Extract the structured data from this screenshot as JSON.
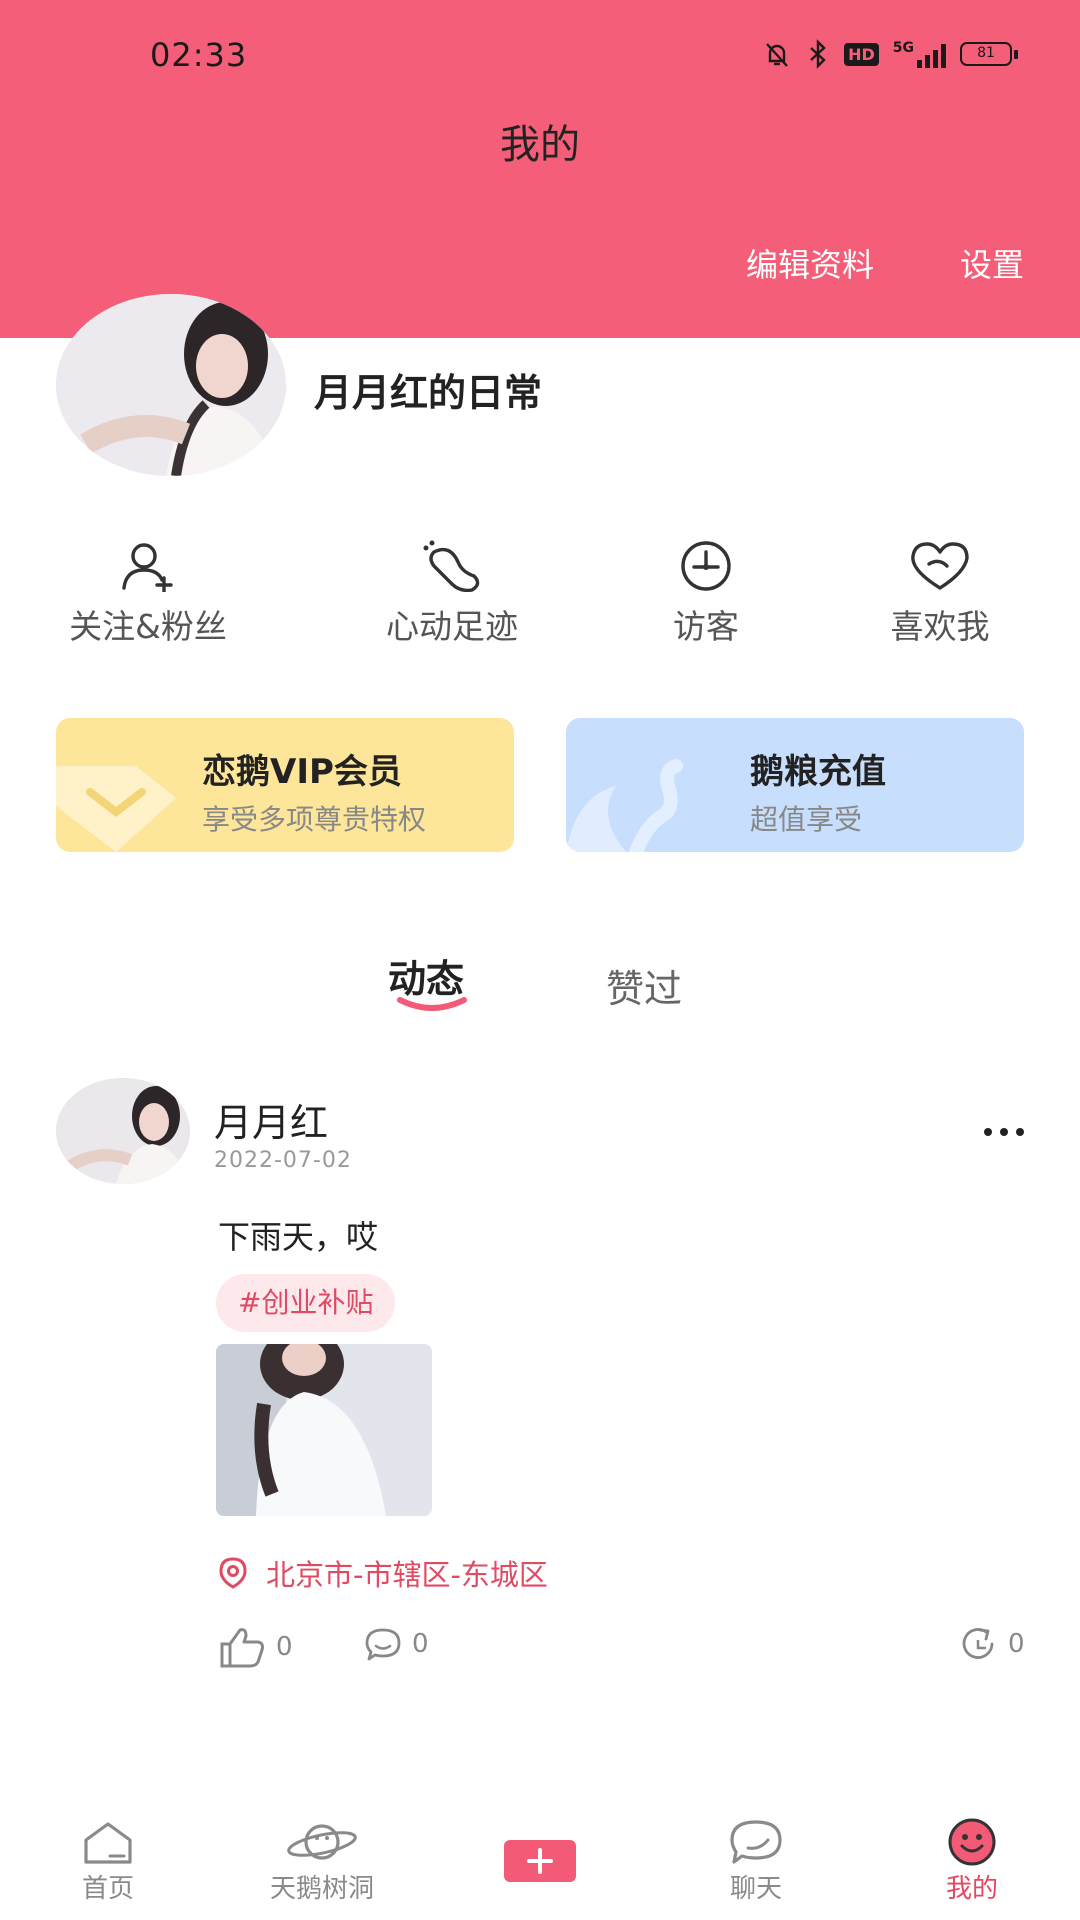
{
  "status_bar": {
    "time": "02:33",
    "network": "5G",
    "hd": "HD",
    "battery": "81"
  },
  "header": {
    "title": "我的",
    "edit_profile": "编辑资料",
    "settings": "设置",
    "color": "#f45e78"
  },
  "profile": {
    "name": "月月红的日常"
  },
  "quick_nav": [
    {
      "label": "关注&粉丝",
      "icon": "follow-fans-icon"
    },
    {
      "label": "心动足迹",
      "icon": "footprint-icon"
    },
    {
      "label": "访客",
      "icon": "visitor-clock-icon"
    },
    {
      "label": "喜欢我",
      "icon": "heart-icon"
    }
  ],
  "cards": {
    "vip": {
      "title": "恋鹅VIP会员",
      "subtitle": "享受多项尊贵特权",
      "color": "#fde59a"
    },
    "recharge": {
      "title": "鹅粮充值",
      "subtitle": "超值享受",
      "color": "#c7defd"
    }
  },
  "tabs": [
    {
      "label": "动态",
      "active": true
    },
    {
      "label": "赞过",
      "active": false
    }
  ],
  "post": {
    "author": "月月红",
    "date": "2022-07-02",
    "text": "下雨天，哎",
    "tag": "#创业补贴",
    "location": "北京市-市辖区-东城区",
    "likes": "0",
    "comments": "0",
    "shares": "0"
  },
  "bottom_nav": [
    {
      "label": "首页",
      "icon": "home-icon",
      "active": false
    },
    {
      "label": "天鹅树洞",
      "icon": "planet-icon",
      "active": false
    },
    {
      "label": "",
      "icon": "plus-icon",
      "active": false
    },
    {
      "label": "聊天",
      "icon": "chat-bubble-icon",
      "active": false
    },
    {
      "label": "我的",
      "icon": "smiley-icon",
      "active": true
    }
  ],
  "accent_color": "#e14a63"
}
